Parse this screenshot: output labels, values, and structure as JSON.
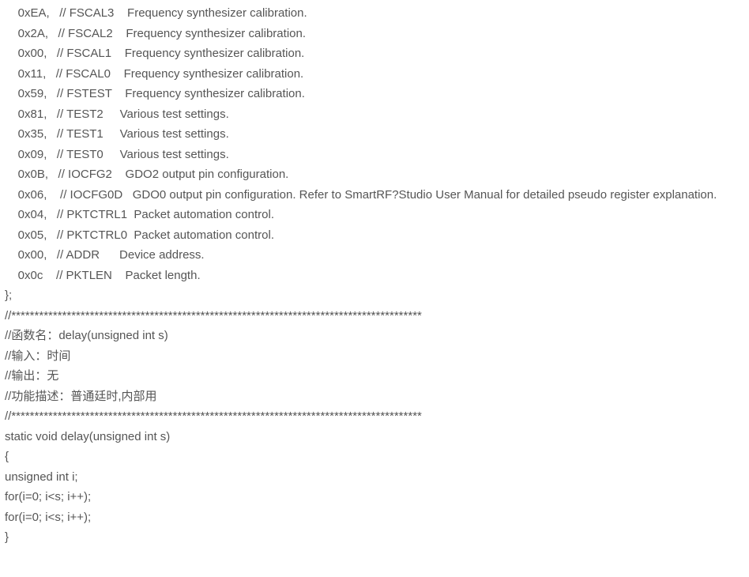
{
  "lines": [
    "    0xEA,   // FSCAL3    Frequency synthesizer calibration.",
    "    0x2A,   // FSCAL2    Frequency synthesizer calibration.",
    "    0x00,   // FSCAL1    Frequency synthesizer calibration.",
    "    0x11,   // FSCAL0    Frequency synthesizer calibration.",
    "    0x59,   // FSTEST    Frequency synthesizer calibration.",
    "    0x81,   // TEST2     Various test settings.",
    "    0x35,   // TEST1     Various test settings.",
    "    0x09,   // TEST0     Various test settings.",
    "    0x0B,   // IOCFG2    GDO2 output pin configuration.",
    "    0x06,    // IOCFG0D   GDO0 output pin configuration. Refer to SmartRF?Studio User Manual for detailed pseudo register explanation.",
    "    0x04,   // PKTCTRL1  Packet automation control.",
    "    0x05,   // PKTCTRL0  Packet automation control.",
    "    0x00,   // ADDR      Device address.",
    "    0x0c    // PKTLEN    Packet length.",
    "};",
    "//*****************************************************************************************",
    "//函数名：delay(unsigned int s)",
    "//输入：时间",
    "//输出：无",
    "//功能描述：普通廷时,内部用",
    "//*****************************************************************************************",
    "static void delay(unsigned int s)",
    "{",
    "unsigned int i;",
    "for(i=0; i<s; i++);",
    "for(i=0; i<s; i++);",
    "}"
  ]
}
